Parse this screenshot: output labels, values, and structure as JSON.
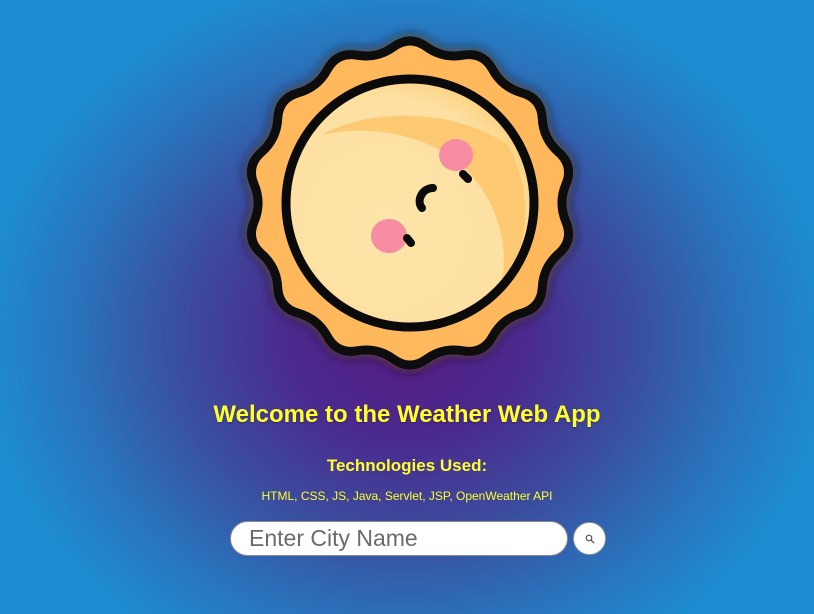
{
  "header": {
    "title": "Welcome to the Weather Web App",
    "technologies_heading": "Technologies Used:",
    "technologies_list": "HTML, CSS, JS, Java, Servlet, JSP, OpenWeather API"
  },
  "search": {
    "placeholder": "Enter City Name",
    "value": "",
    "button_icon": "search-icon"
  },
  "colors": {
    "accent_text": "#ffff2b",
    "background_center": "#561c82",
    "background_edge": "#1e8cd0",
    "sun_fill": "#ffb95c",
    "sun_face": "#fde3a7",
    "cheeks": "#f68ca2"
  }
}
